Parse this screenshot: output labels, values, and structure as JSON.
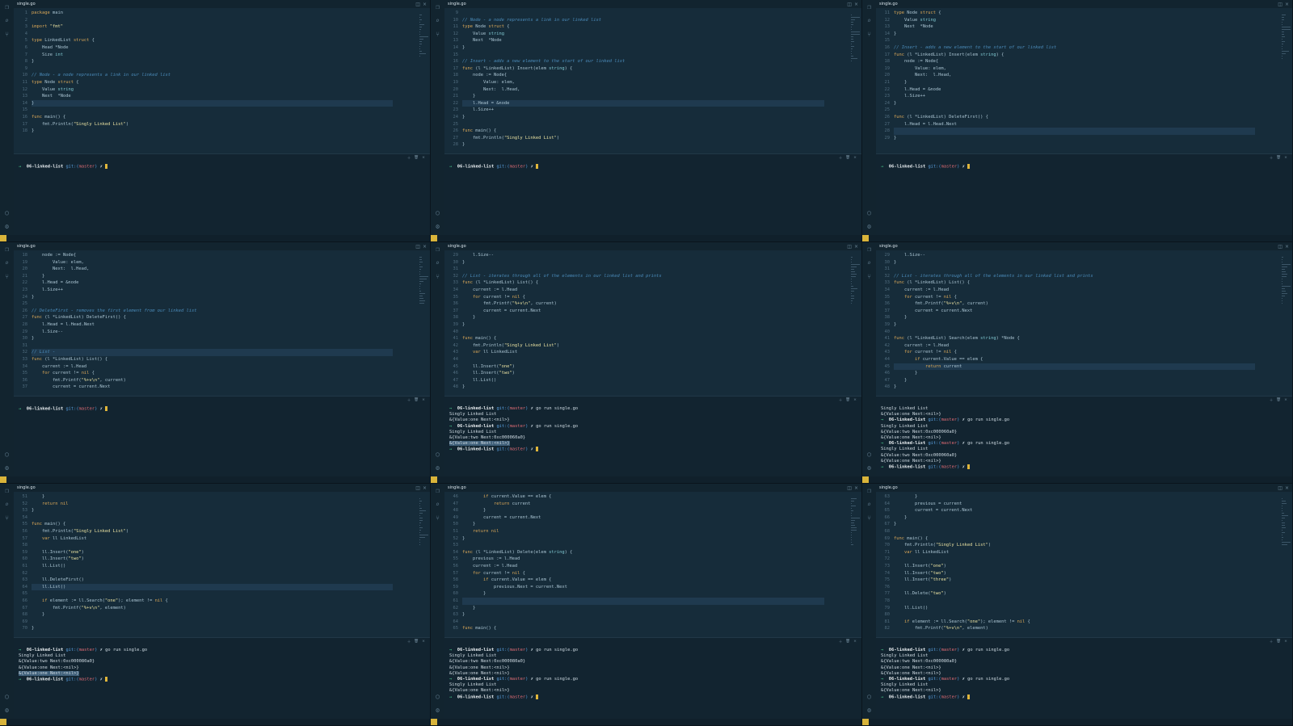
{
  "dir": "06-linked-list",
  "branch_open": "git:(",
  "branch": "master",
  "branch_close": ")",
  "prompt_tail": "✗",
  "cmd": "go run single.go",
  "panels": [
    {
      "file": "single.go",
      "start": 1,
      "lines": [
        "package main",
        "",
        "import \"fmt\"",
        "",
        "type LinkedList struct {",
        "    Head *Node",
        "    Size int",
        "}",
        "",
        "// Node - a node represents a link in our linked list",
        "type Node struct {",
        "    Value string",
        "    Next  *Node",
        "}",
        "",
        "func main() {",
        "    fmt.Println(\"Singly Linked List\")",
        "}"
      ],
      "highlight": 13,
      "terminal": []
    },
    {
      "file": "single.go",
      "start": 9,
      "lines": [
        "",
        "// Node - a node represents a link in our linked list",
        "type Node struct {",
        "    Value string",
        "    Next  *Node",
        "}",
        "",
        "// Insert - adds a new element to the start of our linked list",
        "func (l *LinkedList) Insert(elem string) {",
        "    node := Node{",
        "        Value: elem,",
        "        Next:  l.Head,",
        "    }",
        "    l.Head = &node",
        "    l.Size++",
        "}",
        "",
        "func main() {",
        "    fmt.Println(\"Singly Linked List\")",
        "}"
      ],
      "highlight": 13,
      "terminal": []
    },
    {
      "file": "single.go",
      "start": 11,
      "lines": [
        "type Node struct {",
        "    Value string",
        "    Next  *Node",
        "}",
        "",
        "// Insert - adds a new element to the start of our linked list",
        "func (l *LinkedList) Insert(elem string) {",
        "    node := Node{",
        "        Value: elem,",
        "        Next:  l.Head,",
        "    }",
        "    l.Head = &node",
        "    l.Size++",
        "}",
        "",
        "func (l *LinkedList) DeleteFirst() {",
        "    l.Head = l.Head.Next",
        "",
        "}"
      ],
      "highlight": 17,
      "terminal": []
    },
    {
      "file": "single.go",
      "start": 18,
      "lines": [
        "    node := Node{",
        "        Value: elem,",
        "        Next:  l.Head,",
        "    }",
        "    l.Head = &node",
        "    l.Size++",
        "}",
        "",
        "// DeleteFirst - removes the first element from our linked list",
        "func (l *LinkedList) DeleteFirst() {",
        "    l.Head = l.Head.Next",
        "    l.Size--",
        "}",
        "",
        "// List -",
        "func (l *LinkedList) List() {",
        "    current := l.Head",
        "    for current != nil {",
        "        fmt.Printf(\"%+v\\n\", current)",
        "        current = current.Next"
      ],
      "highlight": 14,
      "terminal": []
    },
    {
      "file": "single.go",
      "start": 29,
      "lines": [
        "    l.Size--",
        "}",
        "",
        "// List - iterates through all of the elements in our linked list and prints",
        "func (l *LinkedList) List() {",
        "    current := l.Head",
        "    for current != nil {",
        "        fmt.Printf(\"%+v\\n\", current)",
        "        current = current.Next",
        "    }",
        "}",
        "",
        "func main() {",
        "    fmt.Println(\"Singly Linked List\")",
        "    var ll LinkedList",
        "",
        "    ll.Insert(\"one\")",
        "    ll.Insert(\"two\")",
        "    ll.List()",
        "}"
      ],
      "highlight": -1,
      "terminal": [
        {
          "p": 1,
          "text": "go run single.go"
        },
        {
          "text": "Singly Linked List"
        },
        {
          "text": "&{Value:one Next:<nil>}"
        },
        {
          "p": 1,
          "text": "go run single.go"
        },
        {
          "text": "Singly Linked List"
        },
        {
          "text": "&{Value:two Next:0xc000060a0}"
        },
        {
          "text": "&{Value:one Next:<nil>}",
          "sel": true
        },
        {
          "p": 1,
          "text": "",
          "cur": true
        }
      ]
    },
    {
      "file": "single.go",
      "start": 29,
      "lines": [
        "    l.Size--",
        "}",
        "",
        "// List - iterates through all of the elements in our linked list and prints",
        "func (l *LinkedList) List() {",
        "    current := l.Head",
        "    for current != nil {",
        "        fmt.Printf(\"%+v\\n\", current)",
        "        current = current.Next",
        "    }",
        "}",
        "",
        "func (l *LinkedList) Search(elem string) *Node {",
        "    current := l.Head",
        "    for current != nil {",
        "        if current.Value == elem {",
        "            return current",
        "        }",
        "    }",
        "}"
      ],
      "highlight": 16,
      "terminal": [
        {
          "text": "Singly Linked List"
        },
        {
          "text": "&{Value:one Next:<nil>}"
        },
        {
          "p": 1,
          "text": "go run single.go"
        },
        {
          "text": "Singly Linked List"
        },
        {
          "text": "&{Value:two Next:0xc000060a0}"
        },
        {
          "text": "&{Value:one Next:<nil>}"
        },
        {
          "p": 1,
          "text": "go run single.go"
        },
        {
          "text": "Singly Linked List"
        },
        {
          "text": "&{Value:two Next:0xc000060a0}"
        },
        {
          "text": "&{Value:one Next:<nil>}"
        },
        {
          "p": 1,
          "text": "",
          "cur": true
        }
      ]
    },
    {
      "file": "single.go",
      "start": 51,
      "lines": [
        "    }",
        "    return nil",
        "}",
        "",
        "func main() {",
        "    fmt.Println(\"Singly Linked List\")",
        "    var ll LinkedList",
        "",
        "    ll.Insert(\"one\")",
        "    ll.Insert(\"two\")",
        "    ll.List()",
        "",
        "    ll.DeleteFirst()",
        "    ll.List()",
        "",
        "    if element := ll.Search(\"one\"); element != nil {",
        "        fmt.Printf(\"%+v\\n\", element)",
        "    }",
        "",
        "}"
      ],
      "highlight": 13,
      "terminal": [
        {
          "p": 1,
          "text": "go run single.go"
        },
        {
          "text": "Singly Linked List"
        },
        {
          "text": "&{Value:two Next:0xc000080a0}"
        },
        {
          "text": "&{Value:one Next:<nil>}"
        },
        {
          "text": "&{Value:one Next:<nil>}",
          "sel": true
        },
        {
          "p": 1,
          "text": "",
          "cur": true
        }
      ]
    },
    {
      "file": "single.go",
      "start": 46,
      "lines": [
        "        if current.Value == elem {",
        "            return current",
        "        }",
        "        current = current.Next",
        "    }",
        "    return nil",
        "}",
        "",
        "func (l *LinkedList) Delete(elem string) {",
        "    previous := l.Head",
        "    current := l.Head",
        "    for current != nil {",
        "        if current.Value == elem {",
        "            previous.Next = current.Next",
        "        }",
        "",
        "    }",
        "}",
        "",
        "func main() {"
      ],
      "highlight": 15,
      "terminal": [
        {
          "p": 1,
          "text": "go run single.go"
        },
        {
          "text": "Singly Linked List"
        },
        {
          "text": "&{Value:two Next:0xc000080a0}"
        },
        {
          "text": "&{Value:one Next:<nil>}"
        },
        {
          "text": "&{Value:one Next:<nil>}"
        },
        {
          "p": 1,
          "text": "go run single.go"
        },
        {
          "text": "Singly Linked List"
        },
        {
          "text": "&{Value:one Next:<nil>}"
        },
        {
          "p": 1,
          "text": "",
          "cur": true
        }
      ]
    },
    {
      "file": "single.go",
      "start": 63,
      "lines": [
        "        }",
        "        previous = current",
        "        current = current.Next",
        "    }",
        "}",
        "",
        "func main() {",
        "    fmt.Println(\"Singly Linked List\")",
        "    var ll LinkedList",
        "",
        "    ll.Insert(\"one\")",
        "    ll.Insert(\"two\")",
        "    ll.Insert(\"three\")",
        "",
        "    ll.Delete(\"two\")",
        "",
        "    ll.List()",
        "",
        "    if element := ll.Search(\"one\"); element != nil {",
        "        fmt.Printf(\"%+v\\n\", element)"
      ],
      "highlight": -1,
      "terminal": [
        {
          "p": 1,
          "text": "go run single.go"
        },
        {
          "text": "Singly Linked List"
        },
        {
          "text": "&{Value:two Next:0xc000080a0}"
        },
        {
          "text": "&{Value:one Next:<nil>}"
        },
        {
          "text": "&{Value:one Next:<nil>}"
        },
        {
          "p": 1,
          "text": "go run single.go"
        },
        {
          "text": "Singly Linked List"
        },
        {
          "text": "&{Value:one Next:<nil>}"
        },
        {
          "p": 1,
          "text": "",
          "cur": true
        }
      ]
    }
  ]
}
